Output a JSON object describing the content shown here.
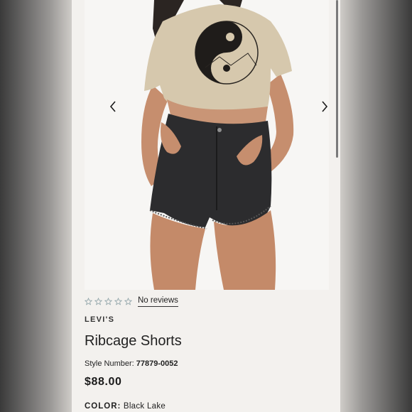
{
  "product": {
    "rating_stars": 0,
    "rating_max": 5,
    "reviews_label": "No reviews",
    "brand": "LEVI'S",
    "name": "Ribcage Shorts",
    "style_number_label": "Style Number:",
    "style_number": "77879-0052",
    "price": "$88.00",
    "color_label": "COLOR:",
    "color_value": "Black Lake"
  },
  "gallery": {
    "prev_icon": "chevron-left-icon",
    "next_icon": "chevron-right-icon"
  },
  "colors": {
    "star_outline": "#8fa3a8",
    "text": "#222222",
    "page_bg": "#f3f1ee"
  }
}
